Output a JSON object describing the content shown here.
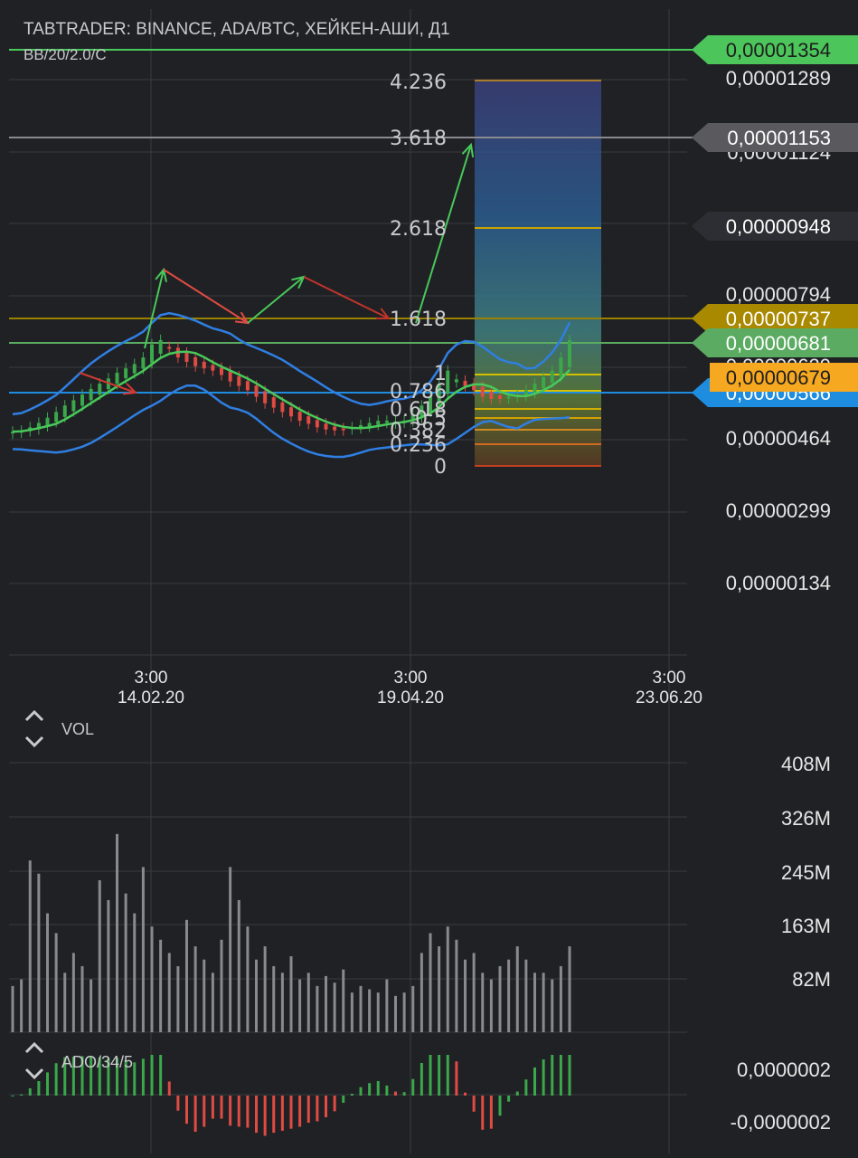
{
  "header": {
    "title": "TABTRADER: BINANCE, ADA/BTC, ХЕЙКЕН-АШИ, Д1",
    "indicator": "BB/20/2.0/C"
  },
  "colors": {
    "background": "#202125",
    "grid": "#3a3b40",
    "price_up": "#3aa84b",
    "price_down": "#e04b43",
    "bb_band": "#2f7fe3",
    "bb_mid": "#48c95a",
    "fib_line": "#c9a400",
    "volume_bar": "#8a8a8c"
  },
  "price_axis": {
    "ticks": [
      "0,00001289",
      "0,00001124",
      "0,00000948",
      "0,00000794",
      "0,00000629",
      "0,00000566",
      "0,00000464",
      "0,00000299",
      "0,00000134"
    ]
  },
  "price_tags": [
    {
      "label": "0,00001354",
      "color": "#4cc55b",
      "text_color": "#1d1d1d"
    },
    {
      "label": "0,00001153",
      "color": "#5a5a5e",
      "text_color": "#ffffff"
    },
    {
      "label": "0,00000948",
      "color": "#2d2e33",
      "text_color": "#ffffff"
    },
    {
      "label": "0,00000737",
      "color": "#a88900",
      "text_color": "#ffffff"
    },
    {
      "label": "0,00000681",
      "color": "#5bab62",
      "text_color": "#ffffff"
    },
    {
      "label": "0,00000679",
      "color": "#f5a820",
      "text_color": "#1d1d1d"
    },
    {
      "label": "0,00000566",
      "color": "#1e8de0",
      "text_color": "#ffffff"
    }
  ],
  "fib_labels": [
    "4.236",
    "3.618",
    "2.618",
    "1.618",
    "1",
    "0.786",
    "0.618",
    "0.5",
    "0.382",
    "0.236",
    "0"
  ],
  "time_axis": [
    {
      "time": "3:00",
      "date": "14.02.20"
    },
    {
      "time": "3:00",
      "date": "19.04.20"
    },
    {
      "time": "3:00",
      "date": "23.06.20"
    }
  ],
  "volume_panel": {
    "label": "VOL",
    "ticks": [
      "408M",
      "326M",
      "245M",
      "163M",
      "82M"
    ]
  },
  "ado_panel": {
    "label": "ADO/34/5",
    "ticks": [
      "0,0000002",
      "-0,0000002"
    ]
  },
  "chart_data": {
    "type": "line",
    "title": "TABTRADER: BINANCE, ADA/BTC, ХЕЙКЕН-АШИ, Д1",
    "y_range": [
      5e-07,
      1.4e-05
    ],
    "series": [
      {
        "name": "BB/20/2.0/C",
        "close": [
          4.8e-06,
          4.82e-06,
          4.9e-06,
          5e-06,
          5.12e-06,
          5.25e-06,
          5.4e-06,
          5.52e-06,
          5.65e-06,
          5.78e-06,
          5.9e-06,
          6.02e-06,
          6.15e-06,
          6.25e-06,
          6.35e-06,
          6.5e-06,
          6.8e-06,
          6.9e-06,
          6.7e-06,
          6.5e-06,
          6.4e-06,
          6.3e-06,
          6.25e-06,
          6.2e-06,
          6.1e-06,
          5.95e-06,
          5.85e-06,
          5.75e-06,
          5.6e-06,
          5.45e-06,
          5.35e-06,
          5.25e-06,
          5.15e-06,
          5.05e-06,
          4.98e-06,
          4.9e-06,
          4.85e-06,
          4.83e-06,
          4.85e-06,
          4.9e-06,
          4.95e-06,
          5e-06,
          5.05e-06,
          5.05e-06,
          5.03e-06,
          5.05e-06,
          5.2e-06,
          5.4e-06,
          5.6e-06,
          5.9e-06,
          6.2e-06,
          6e-06,
          5.85e-06,
          5.75e-06,
          5.6e-06,
          5.55e-06,
          5.55e-06,
          5.6e-06,
          5.65e-06,
          5.75e-06,
          5.9e-06,
          6.05e-06,
          6.2e-06,
          6.5e-06,
          6.9e-06
        ]
      }
    ],
    "fibonacci_extension": {
      "levels": [
        4.236,
        3.618,
        2.618,
        1.618,
        1,
        0.786,
        0.618,
        0.5,
        0.382,
        0.236,
        0
      ]
    },
    "volume": {
      "max": 408000000,
      "values_m": [
        70,
        80,
        260,
        240,
        180,
        150,
        90,
        120,
        100,
        80,
        230,
        200,
        300,
        210,
        180,
        250,
        160,
        140,
        120,
        100,
        170,
        130,
        110,
        90,
        140,
        250,
        200,
        160,
        110,
        130,
        100,
        90,
        115,
        80,
        90,
        70,
        85,
        75,
        95,
        60,
        70,
        65,
        60,
        80,
        55,
        60,
        70,
        120,
        150,
        130,
        160,
        140,
        110,
        120,
        90,
        80,
        100,
        110,
        130,
        110,
        90,
        90,
        80,
        100,
        130
      ]
    }
  }
}
